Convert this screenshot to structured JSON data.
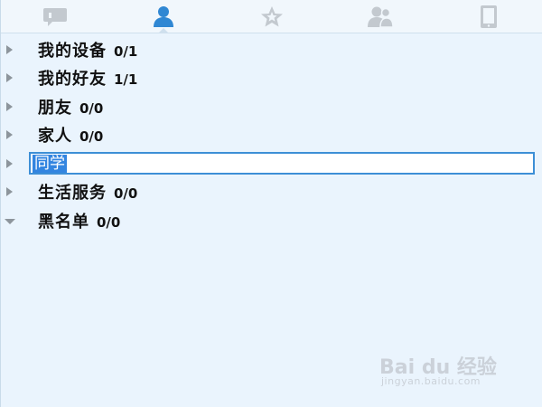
{
  "tabs": [
    {
      "name": "messages",
      "icon": "chat-bubble-icon",
      "active": false
    },
    {
      "name": "contacts",
      "icon": "person-icon",
      "active": true
    },
    {
      "name": "favorites",
      "icon": "star-icon",
      "active": false
    },
    {
      "name": "groups",
      "icon": "people-icon",
      "active": false
    },
    {
      "name": "devices",
      "icon": "tablet-icon",
      "active": false
    }
  ],
  "groups": [
    {
      "name": "我的设备",
      "count": "0/1",
      "expanded": false
    },
    {
      "name": "我的好友",
      "count": "1/1",
      "expanded": false
    },
    {
      "name": "朋友",
      "count": "0/0",
      "expanded": false
    },
    {
      "name": "家人",
      "count": "0/0",
      "expanded": false
    },
    {
      "name": "同学",
      "editing": true,
      "expanded": false
    },
    {
      "name": "生活服务",
      "count": "0/0",
      "expanded": false
    },
    {
      "name": "黑名单",
      "count": "0/0",
      "expanded": true
    }
  ],
  "colors": {
    "accent": "#2f87d3",
    "inactive_icon": "#c3c9cf",
    "panel_bg": "#eaf4fd",
    "selection": "#3385e0"
  },
  "watermark": {
    "brand": "Bai du 经验",
    "url": "jingyan.baidu.com"
  }
}
